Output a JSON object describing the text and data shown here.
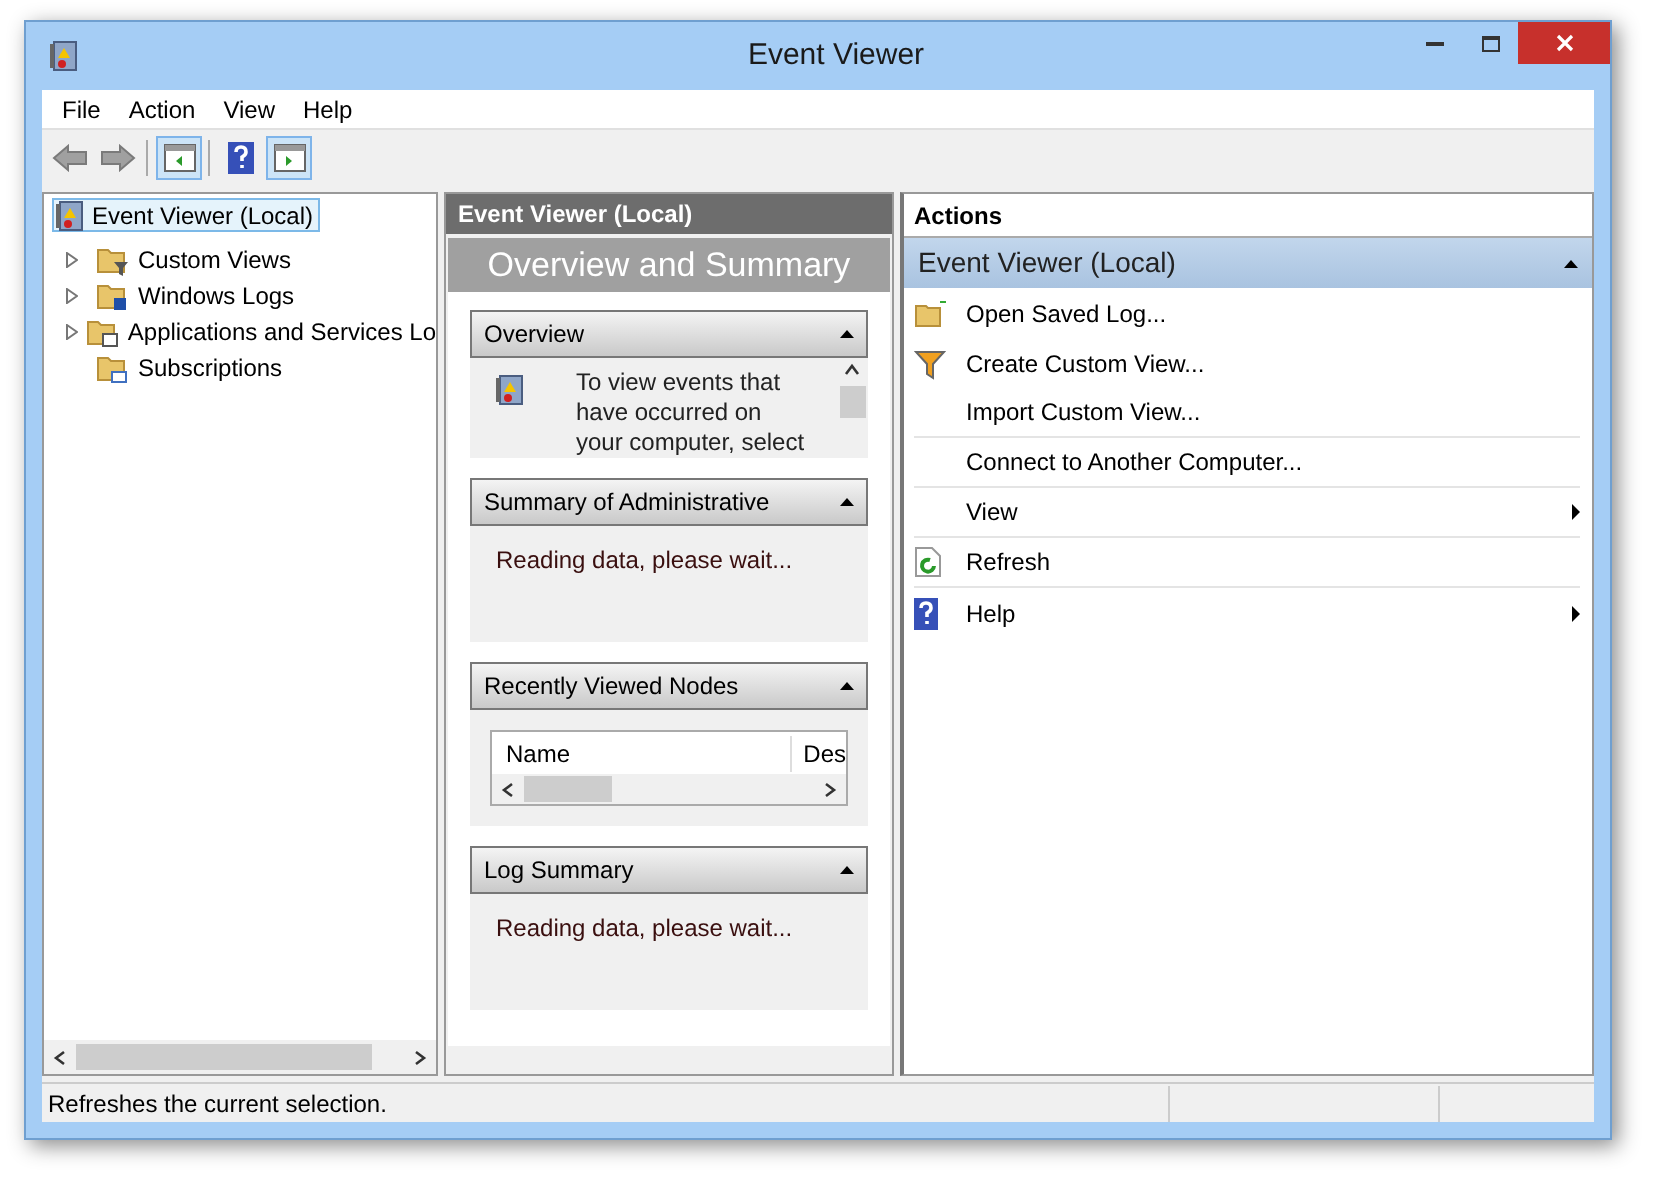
{
  "window": {
    "title": "Event Viewer"
  },
  "menu": [
    "File",
    "Action",
    "View",
    "Help"
  ],
  "toolbar": [
    {
      "kind": "back",
      "pressed": false
    },
    {
      "kind": "forward",
      "pressed": false
    },
    {
      "kind": "tree-pane",
      "pressed": true
    },
    {
      "kind": "help",
      "pressed": false
    },
    {
      "kind": "action-pane",
      "pressed": true
    }
  ],
  "tree": {
    "label": "Event Viewer (Local)",
    "selected": true,
    "children": [
      {
        "kind": "node",
        "label": "Custom Views",
        "expanded": false
      },
      {
        "kind": "node",
        "label": "Windows Logs",
        "expanded": false
      },
      {
        "kind": "node",
        "label": "Applications and Services Lo",
        "expanded": false
      },
      {
        "kind": "leaf",
        "label": "Subscriptions"
      }
    ]
  },
  "center": {
    "header": "Event Viewer (Local)",
    "title": "Overview and Summary",
    "sections": [
      {
        "kind": "overview",
        "title": "Overview",
        "expanded": true,
        "text": "To view events that have occurred on your computer, select"
      },
      {
        "kind": "text",
        "title": "Summary of Administrative",
        "expanded": true,
        "text": "Reading data, please wait..."
      },
      {
        "kind": "table",
        "title": "Recently Viewed Nodes",
        "expanded": true,
        "columns": [
          "Name",
          "Des"
        ]
      },
      {
        "kind": "text",
        "title": "Log Summary",
        "expanded": true,
        "text": "Reading data, please wait..."
      }
    ]
  },
  "actions": {
    "header": "Actions",
    "group": {
      "title": "Event Viewer (Local)",
      "expanded": true
    },
    "items": [
      {
        "kind": "folder",
        "label": "Open Saved Log...",
        "submenu": false
      },
      {
        "kind": "filter",
        "label": "Create Custom View...",
        "submenu": false
      },
      {
        "kind": "plain",
        "label": "Import Custom View...",
        "submenu": false
      },
      {
        "kind": "plain",
        "label": "Connect to Another Computer...",
        "submenu": false
      },
      {
        "kind": "plain",
        "label": "View",
        "submenu": true
      },
      {
        "kind": "refresh",
        "label": "Refresh",
        "submenu": false
      },
      {
        "kind": "help",
        "label": "Help",
        "submenu": true
      }
    ]
  },
  "status_bar": {
    "text": "Refreshes the current selection."
  }
}
